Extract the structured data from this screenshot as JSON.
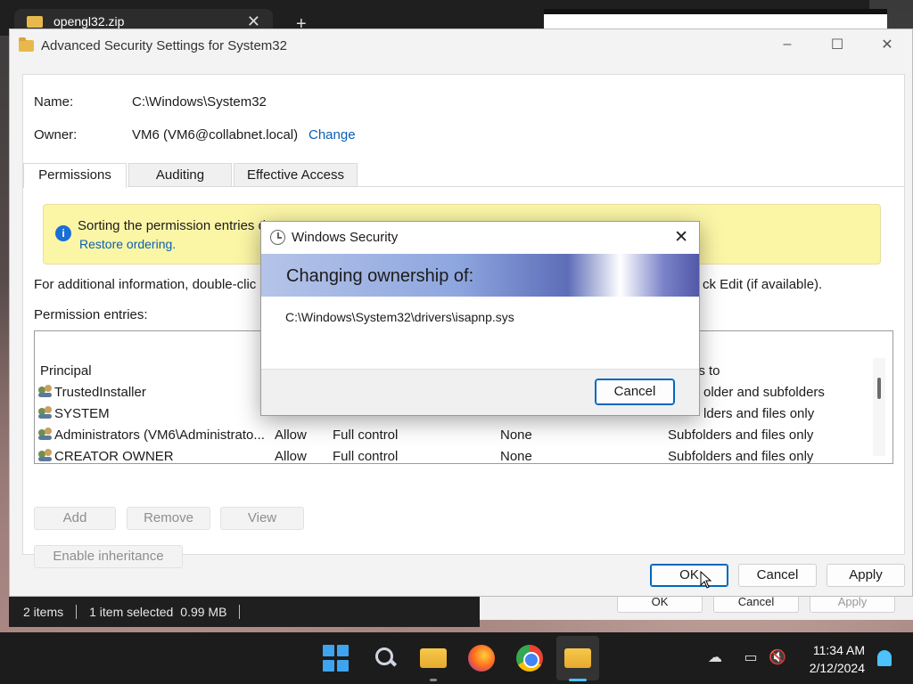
{
  "background": {
    "explorer_tab": "opengl32.zip",
    "statusbar": {
      "items": "2 items",
      "selected": "1 item selected",
      "size": "0.99 MB"
    },
    "bg_buttons": {
      "ok": "OK",
      "cancel": "Cancel",
      "apply": "Apply"
    }
  },
  "window": {
    "title": "Advanced Security Settings for System32",
    "name_label": "Name:",
    "name_value": "C:\\Windows\\System32",
    "owner_label": "Owner:",
    "owner_value": "VM6 (VM6@collabnet.local)",
    "change_link": "Change",
    "tabs": [
      "Permissions",
      "Auditing",
      "Effective Access"
    ],
    "info_text": "Sorting the permission entries d",
    "info_link": "Restore ordering.",
    "help_text": "For additional information, double-clic",
    "help_text_right": "ck Edit (if available).",
    "perm_entries_label": "Permission entries:",
    "columns": {
      "principal": "Principal",
      "applies_to": "es to"
    },
    "rows": [
      {
        "principal": "TrustedInstaller",
        "type": "",
        "access": "",
        "inherited": "",
        "applies": "older and subfolders"
      },
      {
        "principal": "SYSTEM",
        "type": "",
        "access": "",
        "inherited": "",
        "applies": "lders and files only"
      },
      {
        "principal": "Administrators (VM6\\Administrato...",
        "type": "Allow",
        "access": "Full control",
        "inherited": "None",
        "applies": "Subfolders and files only"
      },
      {
        "principal": "CREATOR OWNER",
        "type": "Allow",
        "access": "Full control",
        "inherited": "None",
        "applies": "Subfolders and files only"
      }
    ],
    "buttons": {
      "add": "Add",
      "remove": "Remove",
      "view": "View",
      "enable_inheritance": "Enable inheritance",
      "ok": "OK",
      "cancel": "Cancel",
      "apply": "Apply"
    }
  },
  "dialog": {
    "title": "Windows Security",
    "heading": "Changing ownership of:",
    "path": "C:\\Windows\\System32\\drivers\\isapnp.sys",
    "cancel": "Cancel"
  },
  "taskbar": {
    "time": "11:34 AM",
    "date": "2/12/2024"
  },
  "colors": {
    "accent": "#0067c0",
    "info_bg": "#fbf6a6",
    "link": "#0a5fb4"
  }
}
